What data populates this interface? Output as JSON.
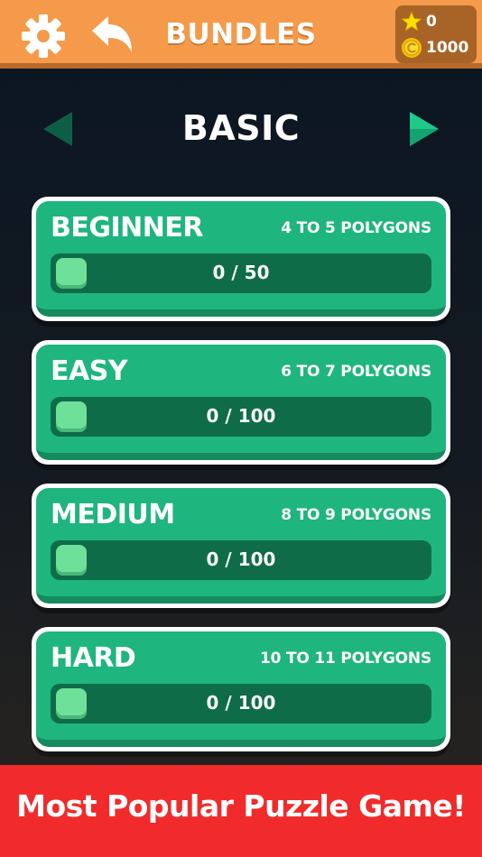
{
  "header": {
    "title": "BUNDLES",
    "settings_icon": "gear-icon",
    "back_icon": "back-arrow-icon",
    "stars": "0",
    "coins": "1000",
    "bar_color": "#f59a4a"
  },
  "bundle": {
    "name": "BASIC",
    "prev_icon": "arrow-left-icon",
    "next_icon": "arrow-right-icon"
  },
  "levels": [
    {
      "title": "BEGINNER",
      "subtitle": "4 TO 5 POLYGONS",
      "progress_text": "0 / 50",
      "completed": 0,
      "total": 50
    },
    {
      "title": "EASY",
      "subtitle": "6 TO 7 POLYGONS",
      "progress_text": "0 / 100",
      "completed": 0,
      "total": 100
    },
    {
      "title": "MEDIUM",
      "subtitle": "8 TO 9 POLYGONS",
      "progress_text": "0 / 100",
      "completed": 0,
      "total": 100
    },
    {
      "title": "HARD",
      "subtitle": "10 TO 11 POLYGONS",
      "progress_text": "0 / 100",
      "completed": 0,
      "total": 100
    }
  ],
  "banner": {
    "text": "Most Popular Puzzle Game!",
    "color": "#f12b2b"
  },
  "colors": {
    "card_green": "#1fb57e",
    "track_green": "#0f6c49",
    "accent_light_green": "#6fe09a"
  }
}
